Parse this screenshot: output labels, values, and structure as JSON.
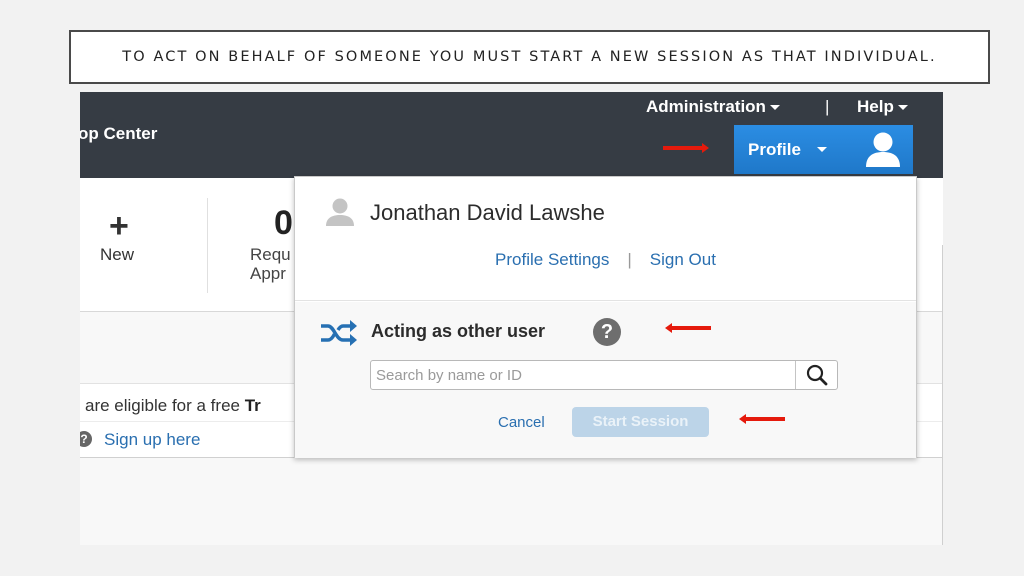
{
  "caption": "TO ACT ON BEHALF OF SOMEONE YOU MUST START A NEW SESSION AS THAT INDIVIDUAL.",
  "header": {
    "app_title": "op Center",
    "nav": {
      "administration": "Administration",
      "separator": "|",
      "help": "Help"
    },
    "profile_button": {
      "label": "Profile",
      "icon": "user-avatar-icon"
    }
  },
  "tiles": {
    "new": {
      "icon": "plus-icon",
      "label": "New"
    },
    "requests": {
      "count": "0",
      "label_line1": "Requ",
      "label_line2": "Appr"
    }
  },
  "promo": {
    "text_prefix": "are eligible for a free ",
    "text_bold": "Tr",
    "link": "Sign up here",
    "icon": "help-circle-icon"
  },
  "profile_dropdown": {
    "user_icon": "user-icon",
    "user_name": "Jonathan David Lawshe",
    "links": {
      "profile_settings": "Profile Settings",
      "separator": "|",
      "sign_out": "Sign Out"
    },
    "acting_as": {
      "icon": "shuffle-icon",
      "title": "Acting as other user",
      "help_icon": "?",
      "search": {
        "placeholder": "Search by name or ID",
        "value": "",
        "icon": "search-icon"
      },
      "cancel_label": "Cancel",
      "start_session_label": "Start Session",
      "start_session_enabled": false
    }
  },
  "annotations": [
    {
      "type": "red-arrow",
      "points": "right",
      "target": "profile-button"
    },
    {
      "type": "red-arrow",
      "points": "left",
      "target": "acting-as-other-user"
    },
    {
      "type": "red-arrow",
      "points": "left",
      "target": "start-session-button"
    }
  ],
  "colors": {
    "topbar": "#363c44",
    "profile_button": "#2185d9",
    "link": "#2a6fb0",
    "start_session_disabled": "#bcd4e8",
    "annotation_arrow": "#e51a0c"
  }
}
